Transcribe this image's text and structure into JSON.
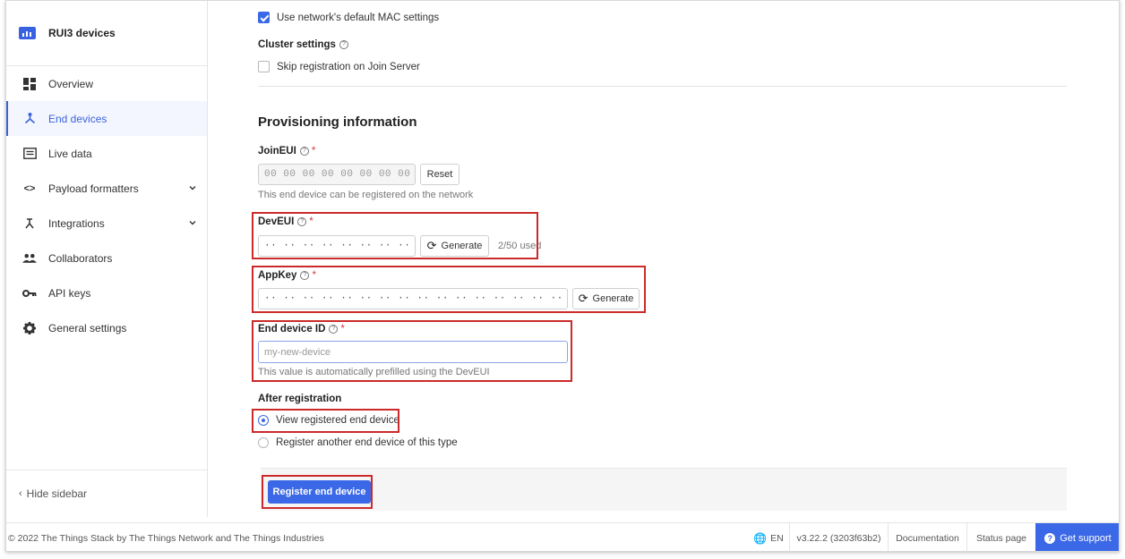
{
  "app": {
    "name": "RUI3 devices"
  },
  "sidebar": {
    "items": [
      {
        "label": "Overview",
        "icon": "overview-icon"
      },
      {
        "label": "End devices",
        "icon": "end-devices-icon",
        "active": true
      },
      {
        "label": "Live data",
        "icon": "live-data-icon"
      },
      {
        "label": "Payload formatters",
        "icon": "code-icon",
        "expandable": true
      },
      {
        "label": "Integrations",
        "icon": "integrations-icon",
        "expandable": true
      },
      {
        "label": "Collaborators",
        "icon": "people-icon"
      },
      {
        "label": "API keys",
        "icon": "key-icon"
      },
      {
        "label": "General settings",
        "icon": "gear-icon"
      }
    ],
    "hide_label": "Hide sidebar"
  },
  "form": {
    "mac_default": {
      "label": "Use network's default MAC settings",
      "checked": true
    },
    "cluster_label": "Cluster settings",
    "skip_join": {
      "label": "Skip registration on Join Server",
      "checked": false
    },
    "section_title": "Provisioning information",
    "join_eui": {
      "label": "JoinEUI",
      "value": "00 00 00 00 00 00 00 00",
      "reset_label": "Reset",
      "hint": "This end device can be registered on the network"
    },
    "dev_eui": {
      "label": "DevEUI",
      "value": "·· ·· ·· ·· ·· ·· ·· ··",
      "generate_label": "Generate",
      "usage": "2/50 used"
    },
    "app_key": {
      "label": "AppKey",
      "value": "·· ·· ·· ·· ·· ·· ·· ·· ·· ·· ·· ·· ·· ·· ·· ··",
      "generate_label": "Generate"
    },
    "device_id": {
      "label": "End device ID",
      "placeholder": "my-new-device",
      "hint": "This value is automatically prefilled using the DevEUI"
    },
    "after_registration": {
      "label": "After registration",
      "options": [
        {
          "label": "View registered end device",
          "selected": true
        },
        {
          "label": "Register another end device of this type",
          "selected": false
        }
      ]
    },
    "submit_label": "Register end device"
  },
  "footer": {
    "copyright": "© 2022 The Things Stack by The Things Network and The Things Industries",
    "language": "EN",
    "version": "v3.22.2 (3203f63b2)",
    "documentation": "Documentation",
    "status_page": "Status page",
    "support": "Get support"
  },
  "colors": {
    "accent": "#3b68e6",
    "highlight": "#cc2a2a",
    "required": "#d83a3a"
  }
}
